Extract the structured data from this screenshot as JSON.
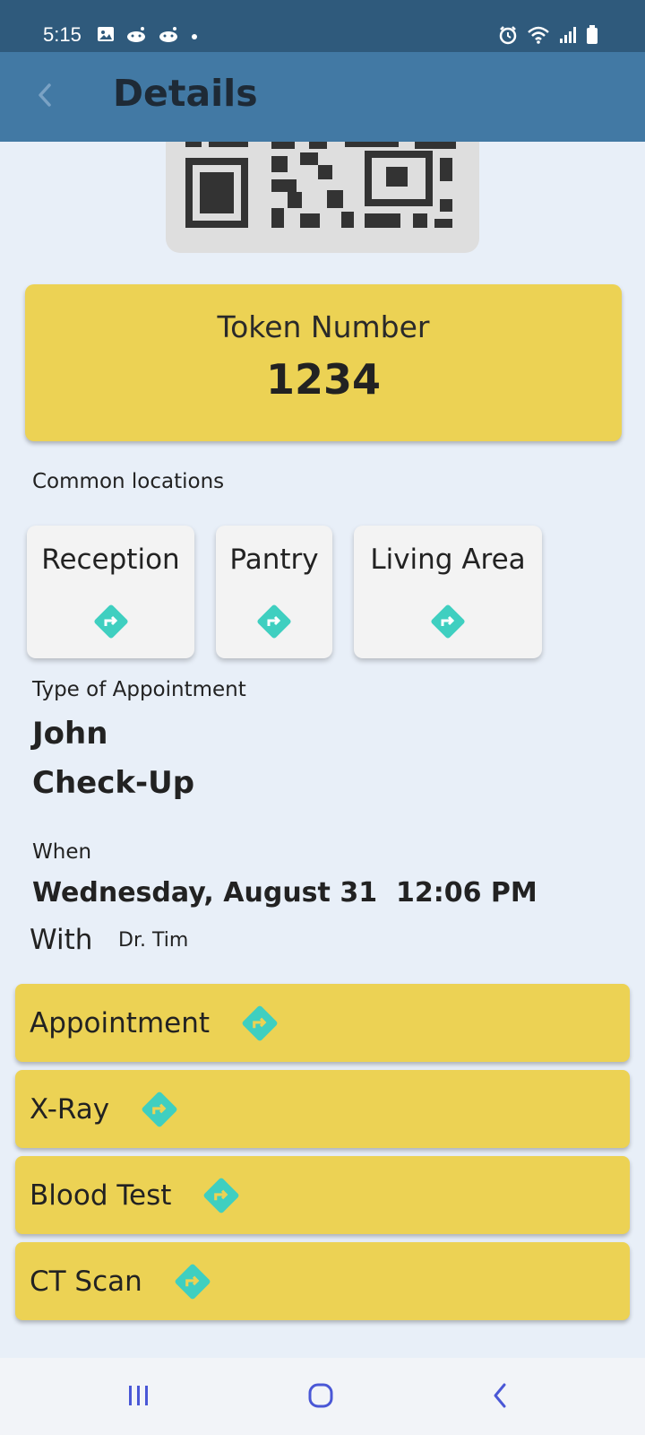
{
  "status_bar": {
    "time": "5:15",
    "left_icons": [
      "gallery-icon",
      "reddit-icon",
      "reddit-icon",
      "dot-icon"
    ],
    "right_icons": [
      "alarm-icon",
      "wifi-icon",
      "signal-icon",
      "battery-icon"
    ]
  },
  "app_bar": {
    "back_icon": "chevron-left-icon",
    "title": "Details",
    "background": "#4279a4"
  },
  "token": {
    "label": "Token Number",
    "value": "1234",
    "background": "#ecd254"
  },
  "locations": {
    "heading": "Common locations",
    "items": [
      {
        "label": "Reception",
        "icon": "directions-icon"
      },
      {
        "label": "Pantry",
        "icon": "directions-icon"
      },
      {
        "label": "Living Area",
        "icon": "directions-icon"
      }
    ]
  },
  "appointment": {
    "type_label": "Type of Appointment",
    "patient": "John",
    "type": "Check-Up",
    "when_label": "When",
    "when_value": "Wednesday, August 31  12:06 PM",
    "with_label": "With",
    "with_value": "Dr. Tim"
  },
  "actions": [
    {
      "label": "Appointment",
      "icon": "directions-icon"
    },
    {
      "label": "X-Ray",
      "icon": "directions-icon"
    },
    {
      "label": "Blood Test",
      "icon": "directions-icon"
    },
    {
      "label": "CT Scan",
      "icon": "directions-icon"
    }
  ],
  "nav_bar": {
    "buttons": [
      "recent-apps-icon",
      "home-icon",
      "back-icon"
    ]
  },
  "colors": {
    "accent_teal": "#3fcfc0",
    "card_yellow": "#ecd254",
    "status_bar": "#2f5a7c",
    "page_bg": "#e8eff8"
  }
}
